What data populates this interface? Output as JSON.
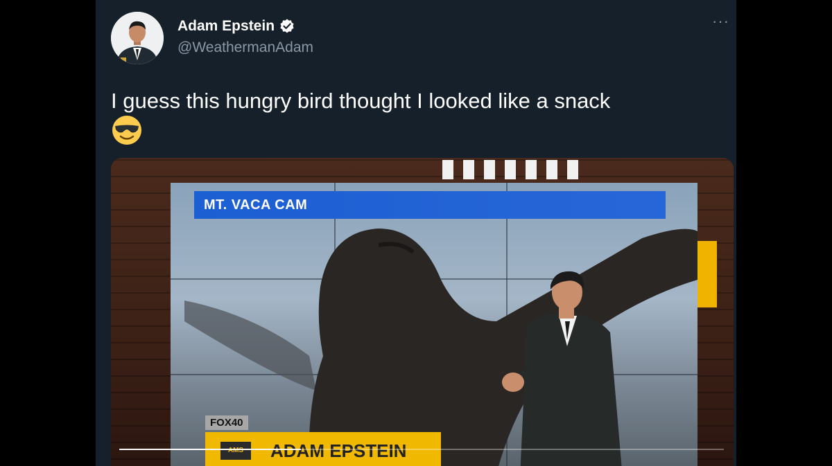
{
  "tweet": {
    "display_name": "Adam Epstein",
    "handle": "@WeathermanAdam",
    "text": "I guess this hungry bird thought I looked like a snack",
    "emoji": "smiling-face-with-sunglasses",
    "more": "···"
  },
  "video": {
    "cam_label": "MT. VACA CAM",
    "station": "FOX40",
    "ams": "AMS",
    "lower_third_name": "ADAM EPSTEIN",
    "progress": 0.3
  },
  "colors": {
    "background": "#15202b",
    "text_secondary": "#8b98a5",
    "verified": "#1d9bf0",
    "accent_yellow": "#f1b800",
    "cam_bar_blue": "#1c5fd3"
  },
  "icons": [
    "verified-badge-icon",
    "more-options-icon",
    "sunglasses-emoji-icon"
  ]
}
